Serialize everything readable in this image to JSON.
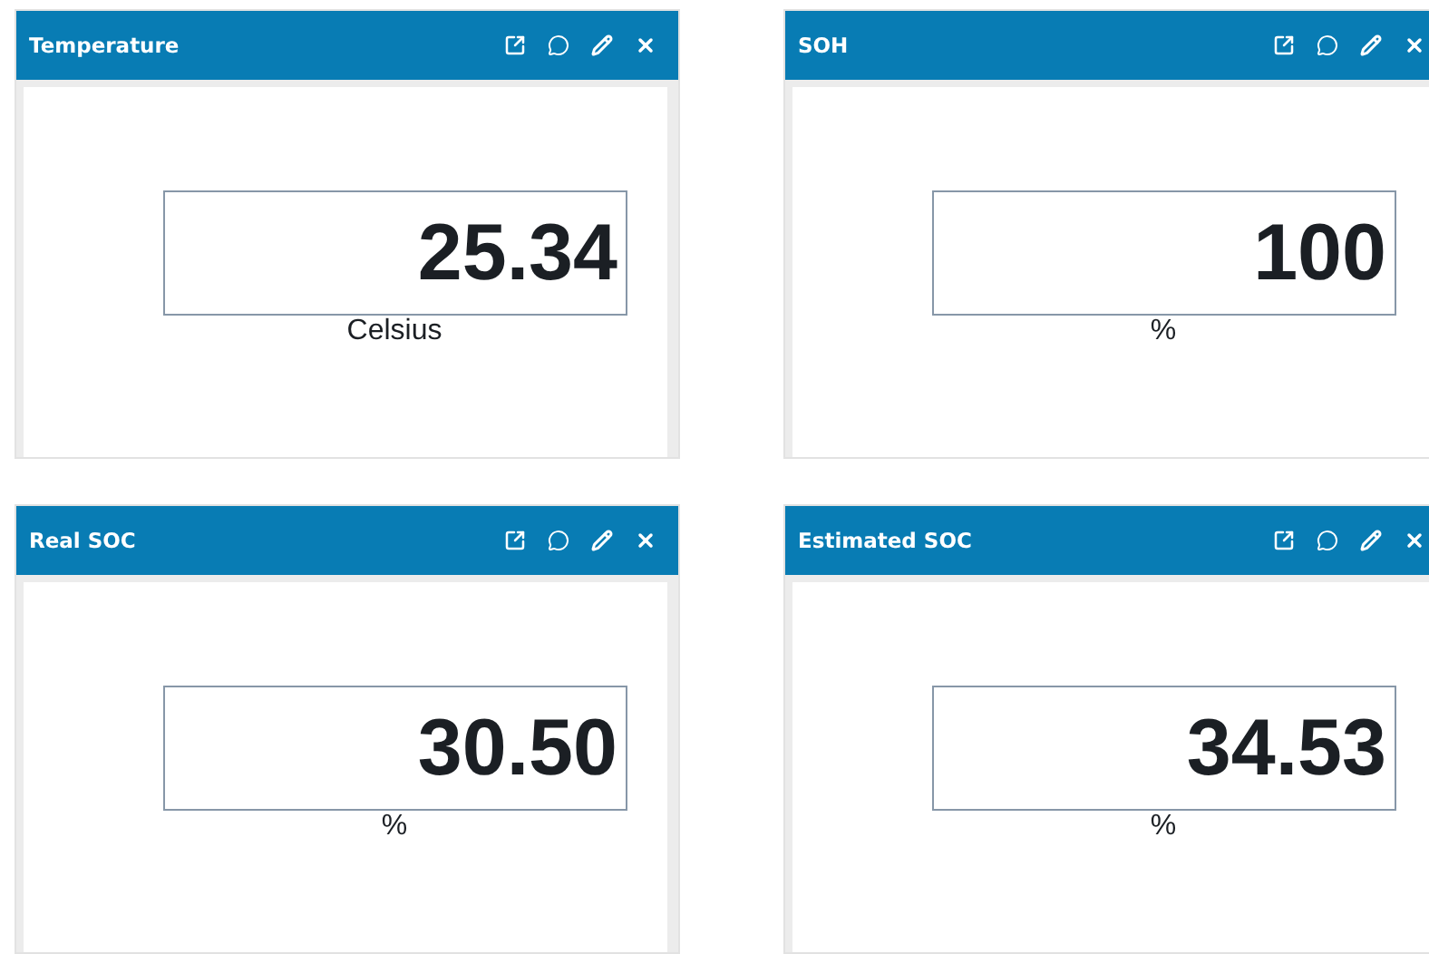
{
  "widgets": [
    {
      "title": "Temperature",
      "value": "25.34",
      "unit": "Celsius"
    },
    {
      "title": "SOH",
      "value": "100",
      "unit": "%"
    },
    {
      "title": "Real SOC",
      "value": "30.50",
      "unit": "%"
    },
    {
      "title": "Estimated SOC",
      "value": "34.53",
      "unit": "%"
    }
  ]
}
